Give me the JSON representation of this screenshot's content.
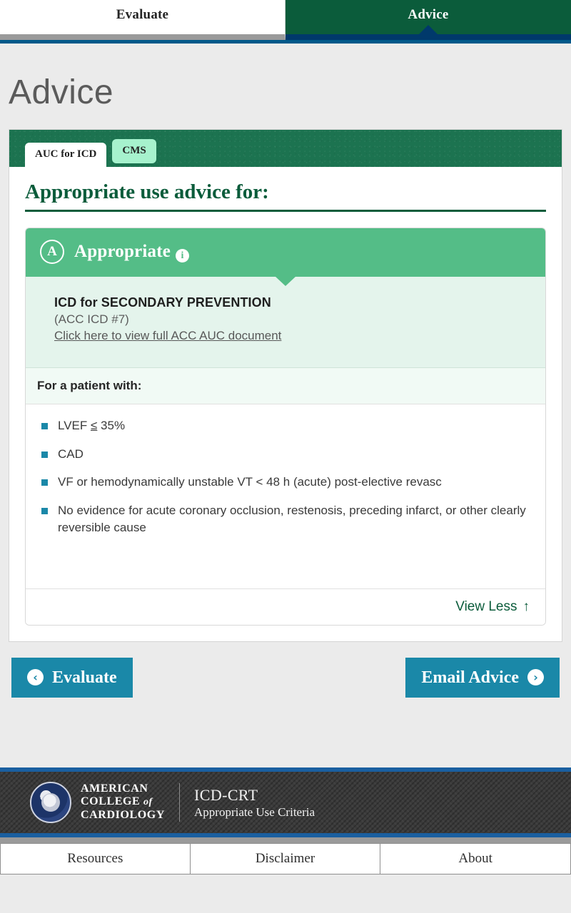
{
  "top_tabs": [
    {
      "label": "Evaluate",
      "active": false
    },
    {
      "label": "Advice",
      "active": true
    }
  ],
  "page_title": "Advice",
  "sub_tabs": [
    {
      "label": "AUC for ICD",
      "selected": true
    },
    {
      "label": "CMS",
      "selected": false
    }
  ],
  "card": {
    "heading": "Appropriate use advice for:",
    "rating": {
      "letter": "A",
      "label": "Appropriate",
      "info_icon": "info-icon",
      "color": "#54bd87"
    },
    "indication": {
      "title": "ICD for SECONDARY PREVENTION",
      "reference": "(ACC ICD #7)",
      "link_text": "Click here to view full ACC AUC document"
    },
    "patient_band_label": "For a patient with:",
    "criteria": [
      {
        "pre": "LVEF ",
        "underline": "≤",
        "post": " 35%"
      },
      {
        "pre": "CAD",
        "underline": "",
        "post": ""
      },
      {
        "pre": "VF or hemodynamically unstable VT < 48 h (acute) post-elective revasc",
        "underline": "",
        "post": ""
      },
      {
        "pre": "No evidence for acute coronary occlusion, restenosis, preceding infarct, or other clearly reversible cause",
        "underline": "",
        "post": ""
      }
    ],
    "view_toggle": {
      "label": "View Less",
      "icon": "arrow-up-icon",
      "glyph": "↑"
    }
  },
  "actions": {
    "back": {
      "label": "Evaluate",
      "icon": "arrow-circle-left-icon",
      "glyph": "‹"
    },
    "forward": {
      "label": "Email Advice",
      "icon": "arrow-circle-right-icon",
      "glyph": "›"
    },
    "color": "#1a88a8"
  },
  "footer": {
    "org_line1": "AMERICAN",
    "org_line2_a": "COLLEGE ",
    "org_line2_b": "of",
    "org_line3": "CARDIOLOGY",
    "product_name": "ICD-CRT",
    "product_sub": "Appropriate Use Criteria"
  },
  "bottom_nav": [
    {
      "label": "Resources"
    },
    {
      "label": "Disclaimer"
    },
    {
      "label": "About"
    }
  ]
}
